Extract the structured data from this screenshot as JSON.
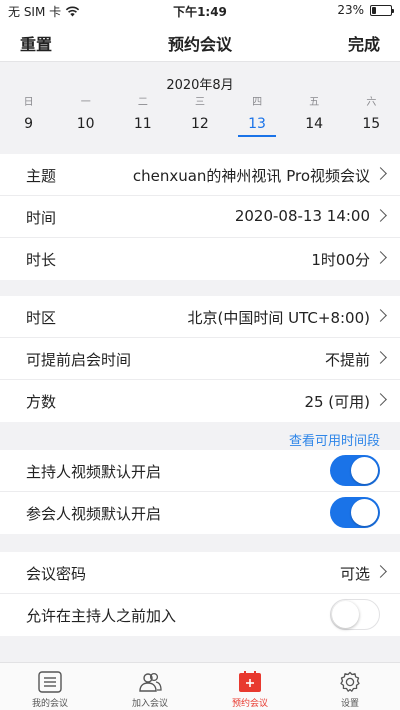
{
  "status_bar": {
    "carrier": "无 SIM 卡",
    "time": "下午1:49",
    "battery_text": "23%",
    "battery_level": 0.23
  },
  "nav": {
    "left": "重置",
    "title": "预约会议",
    "right": "完成"
  },
  "calendar": {
    "month": "2020年8月",
    "days": [
      {
        "weekday": "日",
        "date": "9"
      },
      {
        "weekday": "一",
        "date": "10"
      },
      {
        "weekday": "二",
        "date": "11"
      },
      {
        "weekday": "三",
        "date": "12"
      },
      {
        "weekday": "四",
        "date": "13"
      },
      {
        "weekday": "五",
        "date": "14"
      },
      {
        "weekday": "六",
        "date": "15"
      }
    ],
    "selected_index": 4
  },
  "details": {
    "topic_label": "主题",
    "topic_value": "chenxuan的神州视讯 Pro视频会议",
    "time_label": "时间",
    "time_value": "2020-08-13 14:00",
    "duration_label": "时长",
    "duration_value": "1时00分"
  },
  "settings": {
    "timezone_label": "时区",
    "timezone_value": "北京(中国时间 UTC+8:00)",
    "early_label": "可提前启会时间",
    "early_value": "不提前",
    "parties_label": "方数",
    "parties_value": "25 (可用)"
  },
  "availability_link": "查看可用时间段",
  "video": {
    "host_label": "主持人视频默认开启",
    "host_on": true,
    "participant_label": "参会人视频默认开启",
    "participant_on": true
  },
  "security": {
    "password_label": "会议密码",
    "password_value": "可选",
    "join_before_label": "允许在主持人之前加入",
    "join_before_on": false
  },
  "tabbar": {
    "items": [
      {
        "label": "我的会议",
        "icon": "list-icon"
      },
      {
        "label": "加入会议",
        "icon": "people-icon"
      },
      {
        "label": "预约会议",
        "icon": "calendar-plus-icon"
      },
      {
        "label": "设置",
        "icon": "gear-icon"
      }
    ],
    "active_index": 2
  },
  "colors": {
    "accent": "#1a73e8",
    "link": "#2f86e8",
    "active_tab": "#e8392f"
  }
}
